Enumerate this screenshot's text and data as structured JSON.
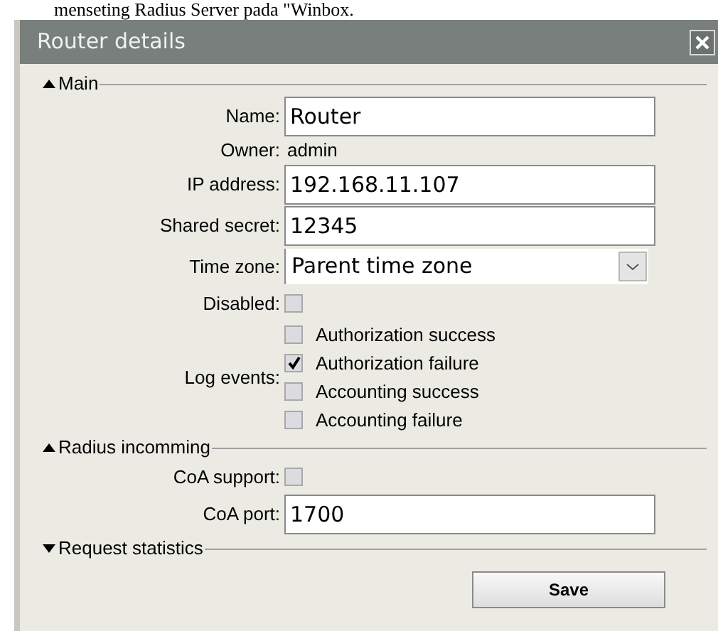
{
  "document_text": "menseting Radius Server pada \"Winbox.",
  "window": {
    "title": "Router details"
  },
  "sections": [
    {
      "title": "Main",
      "expanded": true,
      "fields": [
        {
          "kind": "input",
          "label": "Name:",
          "value": "Router"
        },
        {
          "kind": "readonly",
          "label": "Owner:",
          "value": "admin"
        },
        {
          "kind": "input",
          "label": "IP address:",
          "value": "192.168.11.107"
        },
        {
          "kind": "input",
          "label": "Shared secret:",
          "value": "12345"
        },
        {
          "kind": "select",
          "label": "Time zone:",
          "value": "Parent time zone"
        },
        {
          "kind": "checkbox",
          "label": "Disabled:",
          "checked": false
        },
        {
          "kind": "checklist",
          "label": "Log events:",
          "items": [
            {
              "label": "Authorization success",
              "checked": false
            },
            {
              "label": "Authorization failure",
              "checked": true
            },
            {
              "label": "Accounting success",
              "checked": false
            },
            {
              "label": "Accounting failure",
              "checked": false
            }
          ]
        }
      ]
    },
    {
      "title": "Radius incomming",
      "expanded": true,
      "fields": [
        {
          "kind": "checkbox",
          "label": "CoA support:",
          "checked": false
        },
        {
          "kind": "input",
          "label": "CoA port:",
          "value": "1700"
        }
      ]
    },
    {
      "title": "Request statistics",
      "expanded": false
    }
  ],
  "buttons": [
    {
      "label": "Save"
    }
  ]
}
